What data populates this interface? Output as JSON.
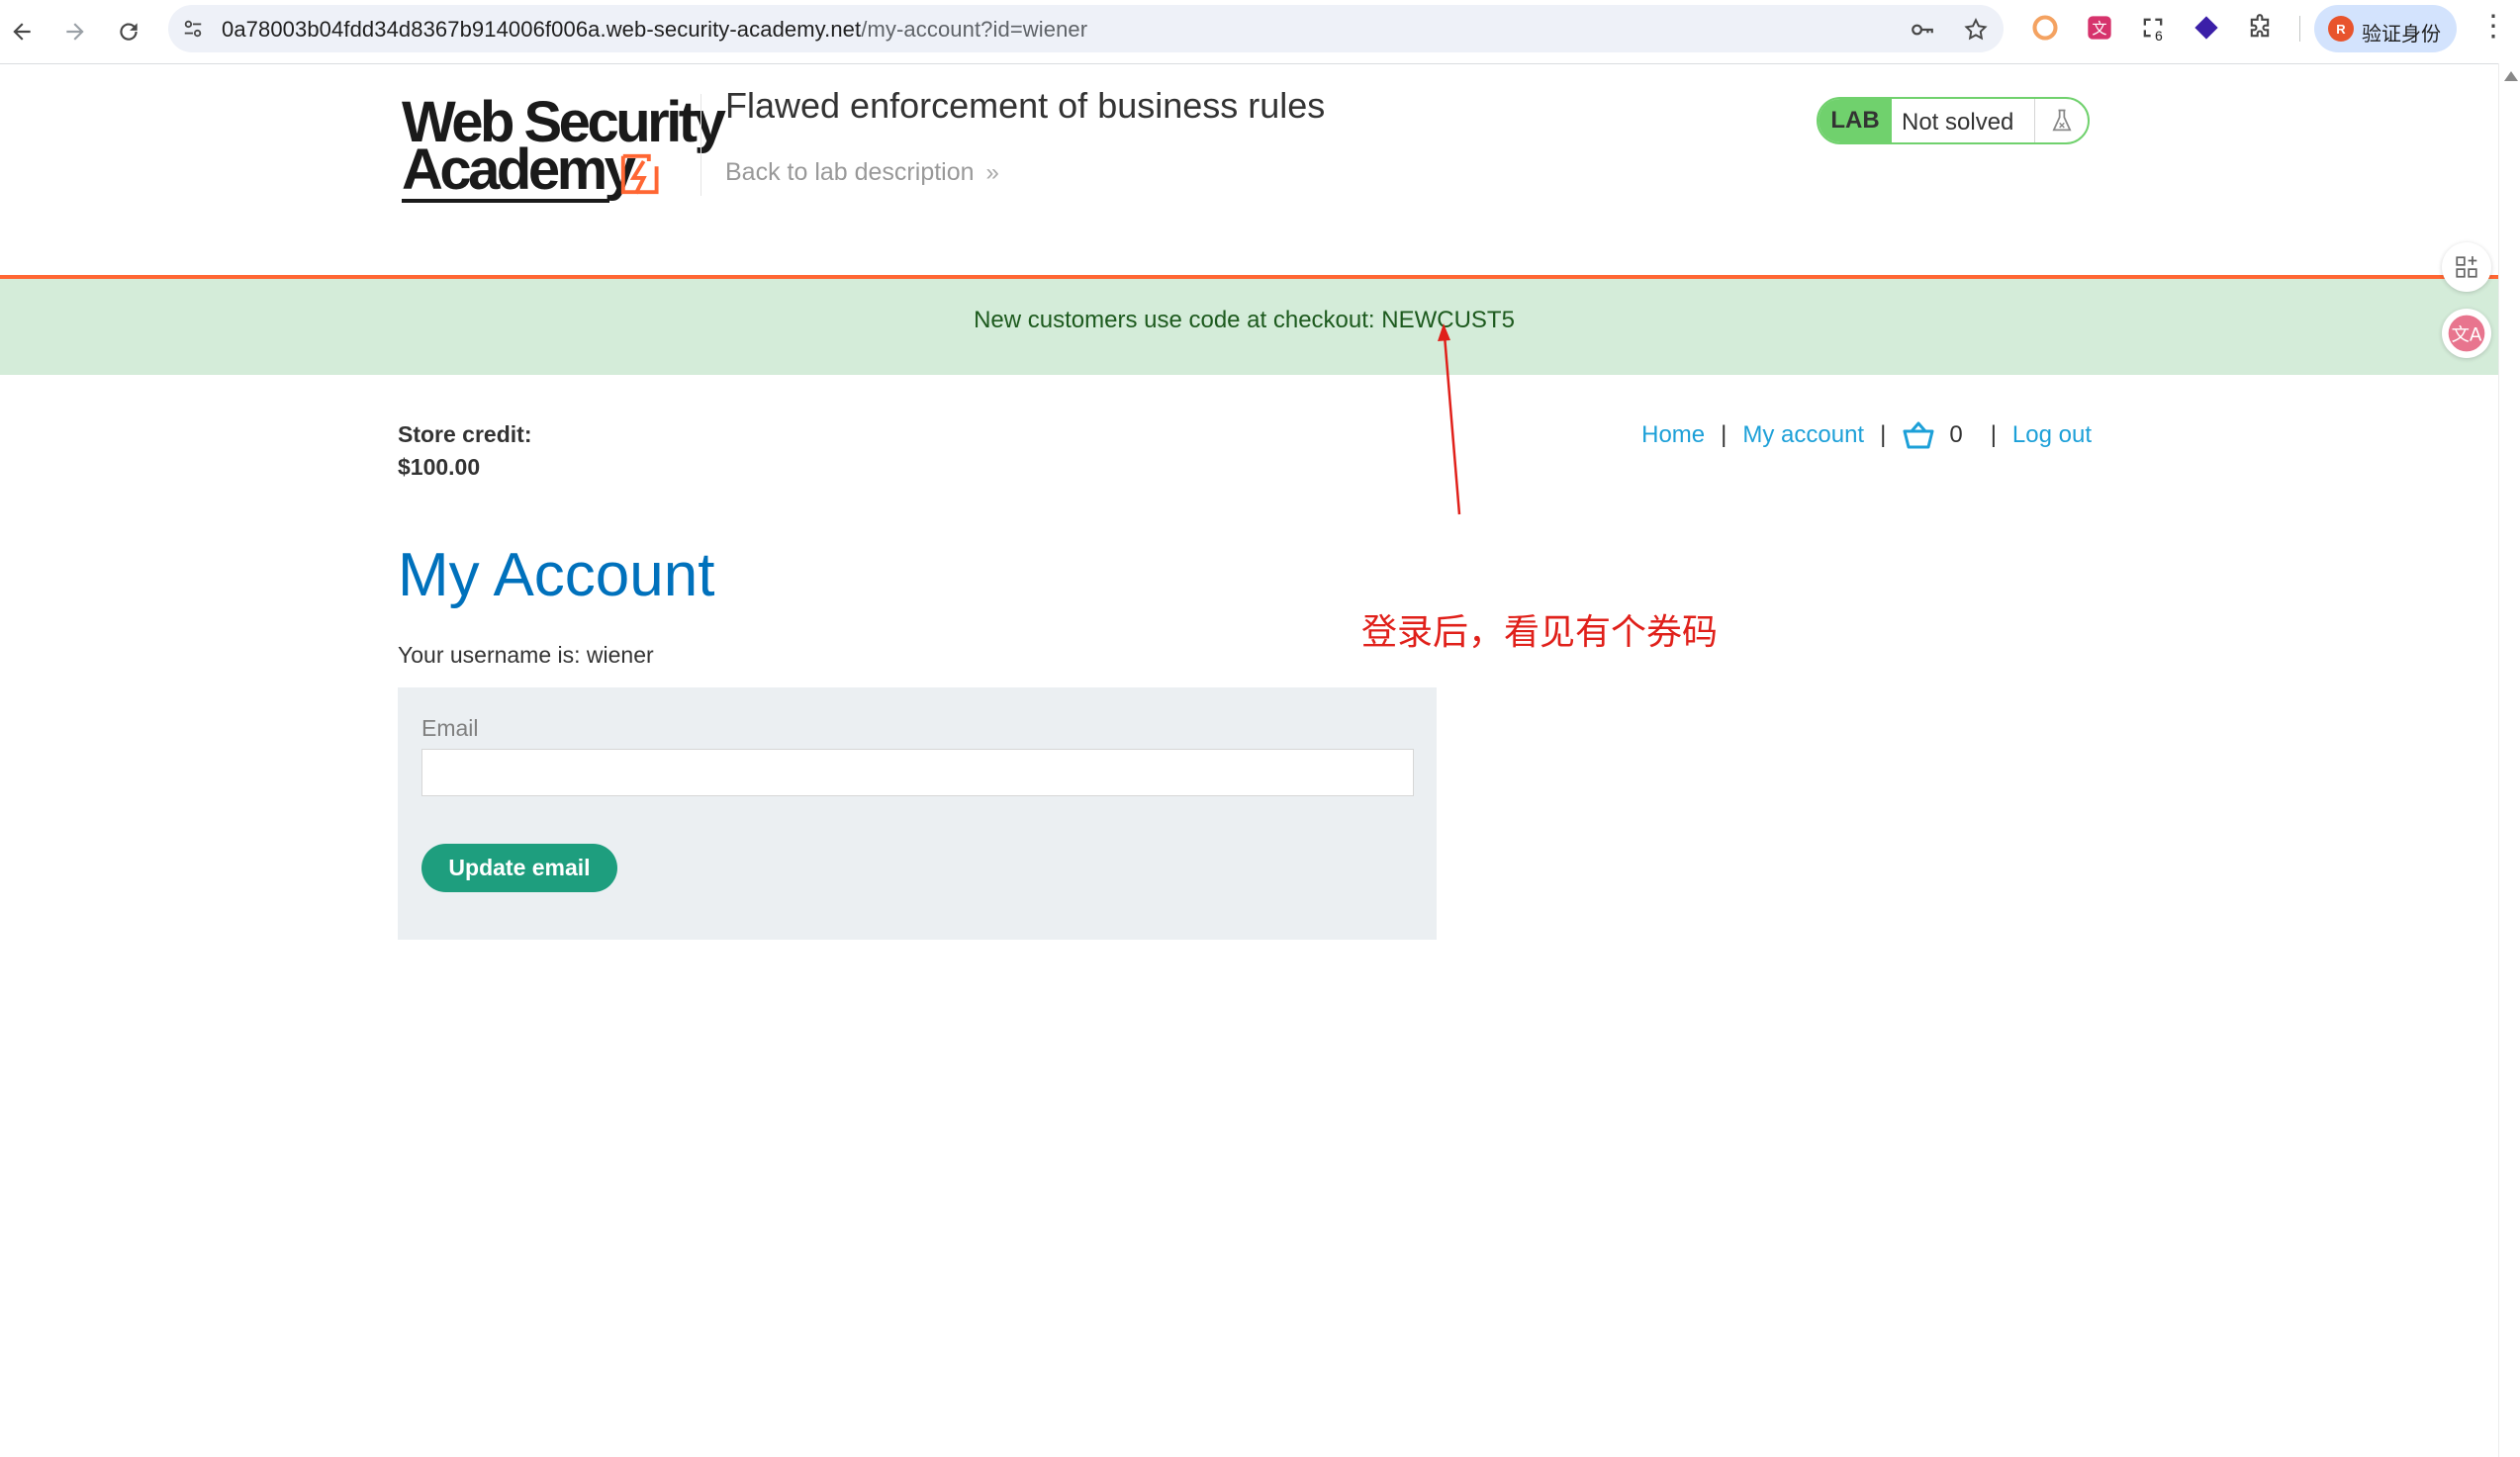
{
  "browser": {
    "url_host": "0a78003b04fdd34d8367b914006f006a.web-security-academy.net",
    "url_path": "/my-account?id=wiener",
    "extension_badge": "6",
    "profile_label": "验证身份",
    "profile_initial": "R"
  },
  "header": {
    "logo_line1": "Web Security",
    "logo_line2": "Academy",
    "lab_title": "Flawed enforcement of business rules",
    "back_link": "Back to lab description",
    "lab_badge": "LAB",
    "lab_status": "Not solved"
  },
  "banner": {
    "message": "New customers use code at checkout: NEWCUST5"
  },
  "account": {
    "store_credit_label": "Store credit:",
    "store_credit_value": "$100.00",
    "nav_home": "Home",
    "nav_my_account": "My account",
    "cart_count": "0",
    "nav_logout": "Log out",
    "page_title": "My Account",
    "username_text": "Your username is: wiener",
    "email_label": "Email",
    "email_value": "",
    "update_button": "Update email"
  },
  "annotation": {
    "note": "登录后，看见有个券码",
    "color": "#e0201a"
  },
  "colors": {
    "accent_orange": "#ff6633",
    "banner_bg": "#d4ecd9",
    "link_blue": "#1da0d8",
    "title_blue": "#0071bc",
    "button_green": "#1e9e7e",
    "lab_green": "#70d16d"
  }
}
